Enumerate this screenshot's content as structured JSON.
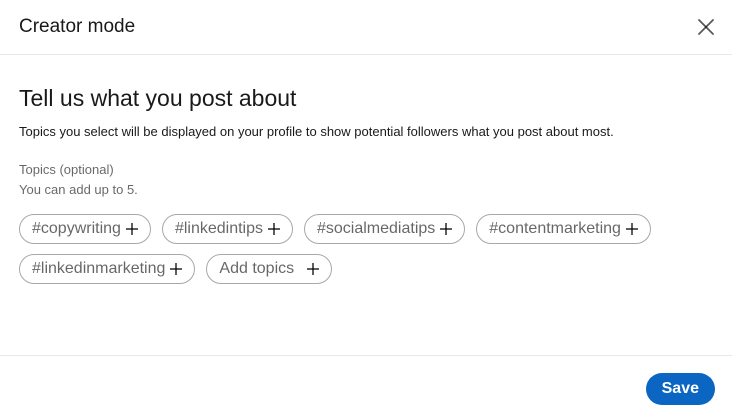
{
  "header": {
    "title": "Creator mode",
    "close_icon": "close-icon"
  },
  "main": {
    "heading": "Tell us what you post about",
    "description": "Topics you select will be displayed on your profile to show potential followers what you post about most.",
    "topics_label": "Topics (optional)",
    "topics_hint": "You can add up to 5.",
    "topics": [
      {
        "label": "#copywriting",
        "icon": "plus-icon"
      },
      {
        "label": "#linkedintips",
        "icon": "plus-icon"
      },
      {
        "label": "#socialmediatips",
        "icon": "plus-icon"
      },
      {
        "label": "#contentmarketing",
        "icon": "plus-icon"
      },
      {
        "label": "#linkedinmarketing",
        "icon": "plus-icon"
      }
    ],
    "add_topics_label": "Add topics"
  },
  "footer": {
    "save_label": "Save"
  },
  "colors": {
    "primary": "#0a66c2",
    "pill_border": "#a8a8a8",
    "divider": "#e8e8e8"
  }
}
